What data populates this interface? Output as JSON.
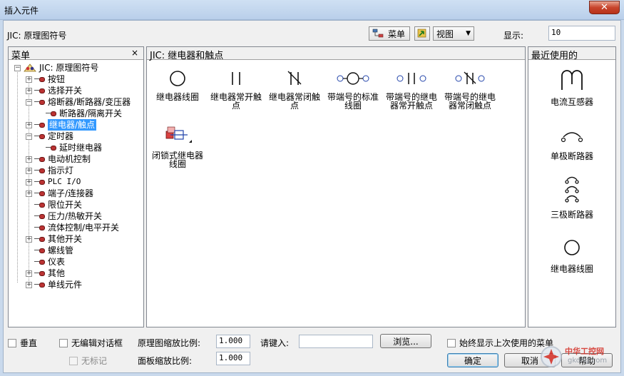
{
  "window": {
    "title": "插入元件",
    "close_glyph": "✕"
  },
  "header": {
    "library_label": "JIC: 原理图符号",
    "menu_button": "菜单",
    "view_button": "视图",
    "show_label": "显示:",
    "show_value": "10"
  },
  "left_panel": {
    "title": "菜单",
    "close": "×",
    "tree": [
      {
        "label": "JIC: 原理图符号",
        "expander": "−",
        "level": 0
      },
      {
        "label": "按钮",
        "expander": "+",
        "level": 1
      },
      {
        "label": "选择开关",
        "expander": "+",
        "level": 1
      },
      {
        "label": "熔断器/断路器/变压器",
        "expander": "−",
        "level": 1
      },
      {
        "label": "断路器/隔离开关",
        "expander": "",
        "level": 2
      },
      {
        "label": "继电器/触点",
        "expander": "+",
        "level": 1,
        "selected": true
      },
      {
        "label": "定时器",
        "expander": "−",
        "level": 1
      },
      {
        "label": "延时继电器",
        "expander": "",
        "level": 2
      },
      {
        "label": "电动机控制",
        "expander": "+",
        "level": 1
      },
      {
        "label": "指示灯",
        "expander": "+",
        "level": 1
      },
      {
        "label": "PLC I/O",
        "expander": "+",
        "level": 1
      },
      {
        "label": "端子/连接器",
        "expander": "+",
        "level": 1
      },
      {
        "label": "限位开关",
        "expander": "",
        "level": 1
      },
      {
        "label": "压力/热敏开关",
        "expander": "",
        "level": 1
      },
      {
        "label": "流体控制/电平开关",
        "expander": "",
        "level": 1
      },
      {
        "label": "其他开关",
        "expander": "+",
        "level": 1
      },
      {
        "label": "螺线管",
        "expander": "",
        "level": 1
      },
      {
        "label": "仪表",
        "expander": "",
        "level": 1
      },
      {
        "label": "其他",
        "expander": "+",
        "level": 1
      },
      {
        "label": "单线元件",
        "expander": "+",
        "level": 1
      }
    ]
  },
  "main_panel": {
    "title": "JIC: 继电器和触点",
    "symbols": [
      {
        "label": "继电器线圈",
        "icon": "coil-icon"
      },
      {
        "label": "继电器常开触点",
        "icon": "no-contact-icon"
      },
      {
        "label": "继电器常闭触点",
        "icon": "nc-contact-icon"
      },
      {
        "label": "带端号的标准线圈",
        "icon": "terminal-coil-icon"
      },
      {
        "label": "带端号的继电器常开触点",
        "icon": "terminal-no-contact-icon"
      },
      {
        "label": "带端号的继电器常闭触点",
        "icon": "terminal-nc-contact-icon"
      },
      {
        "label": "闭锁式继电器线圈",
        "icon": "latching-coil-icon"
      }
    ]
  },
  "recent_panel": {
    "title": "最近使用的",
    "items": [
      {
        "label": "电流互感器",
        "icon": "current-transformer-icon"
      },
      {
        "label": "单极断路器",
        "icon": "single-pole-breaker-icon"
      },
      {
        "label": "三极断路器",
        "icon": "three-pole-breaker-icon"
      },
      {
        "label": "继电器线圈",
        "icon": "coil-icon"
      }
    ]
  },
  "bottom": {
    "vertical": "垂直",
    "no_edit_dialog": "无编辑对话框",
    "no_tag": "无标记",
    "schematic_scale_label": "原理图缩放比例:",
    "schematic_scale_value": "1.000",
    "panel_scale_label": "面板缩放比例:",
    "panel_scale_value": "1.000",
    "type_label": "请键入:",
    "type_value": "",
    "browse": "浏览...",
    "always_show_last": "始终显示上次使用的菜单",
    "ok": "确定",
    "cancel": "取消",
    "help": "帮助"
  },
  "watermark": {
    "line1": "中华工控网",
    "line2": "gkong.com"
  }
}
